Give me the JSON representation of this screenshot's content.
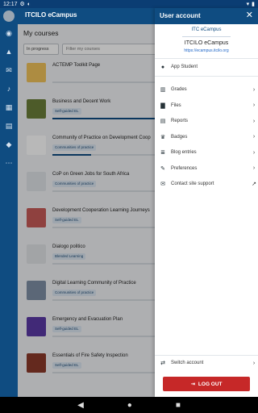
{
  "status": {
    "time": "12:17",
    "icons": [
      "gear-icon",
      "data-icon"
    ]
  },
  "app": {
    "title": "ITCILO eCampus"
  },
  "main": {
    "heading": "My courses",
    "filter": "In progress",
    "search_placeholder": "Filter my courses"
  },
  "courses": [
    {
      "name": "ACTEMP Toolkit Page",
      "badge": "",
      "progress": 0,
      "thumb": "#f0c35a"
    },
    {
      "name": "Business and Decent Work",
      "badge": "Self-guided EL",
      "progress": 1,
      "thumb": "#6b7f3a"
    },
    {
      "name": "Community of Practice on Development Coop",
      "badge": "Communities of practice",
      "progress": 0.3,
      "thumb": "#ffffff"
    },
    {
      "name": "CoP on Green Jobs for South Africa",
      "badge": "Communities of practice",
      "progress": 0,
      "thumb": "#dfe3e8"
    },
    {
      "name": "Development Cooperation Learning Journeys",
      "badge": "Self-guided EL",
      "progress": 0,
      "thumb": "#c75a58"
    },
    {
      "name": "Dialogo politico",
      "badge": "Blended Learning",
      "progress": 0,
      "thumb": "#e1e4e7"
    },
    {
      "name": "Digital Learning Community of Practice",
      "badge": "Communities of practice",
      "progress": 0,
      "thumb": "#7f8fa6"
    },
    {
      "name": "Emergency and Evacuation Plan",
      "badge": "Self-guided EL",
      "progress": 0,
      "thumb": "#5a3aa6"
    },
    {
      "name": "Essentials of Fire Safety Inspection",
      "badge": "Self-guided EL",
      "progress": 0,
      "thumb": "#8b3a2a"
    }
  ],
  "drawer": {
    "title": "User account",
    "site_name": "ITCILO eCampus",
    "logo_text": "ITC eCampus",
    "site_url": "https://ecampus.itcilo.org",
    "user": "App Student",
    "items": [
      {
        "label": "Grades",
        "icon": "grades-icon"
      },
      {
        "label": "Files",
        "icon": "folder-icon"
      },
      {
        "label": "Reports",
        "icon": "reports-icon"
      },
      {
        "label": "Badges",
        "icon": "trophy-icon"
      },
      {
        "label": "Blog entries",
        "icon": "blog-icon"
      },
      {
        "label": "Preferences",
        "icon": "wrench-icon"
      },
      {
        "label": "Contact site support",
        "icon": "mail-icon"
      }
    ],
    "switch_account": "Switch account",
    "logout": "LOG OUT"
  }
}
